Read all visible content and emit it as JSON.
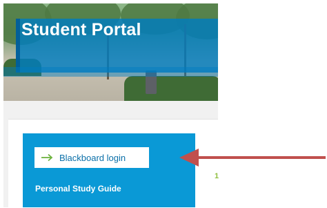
{
  "banner": {
    "title": "Student Portal"
  },
  "panel": {
    "login_button_label": "Blackboard login",
    "study_guide_label": "Personal Study Guide",
    "side_mark": "1"
  },
  "icons": {
    "login_arrow": "arrow-right-icon",
    "annotation_arrow": "arrow-left-icon"
  },
  "colors": {
    "accent_blue": "#0a99d6",
    "login_arrow_green": "#6db33f",
    "annotation_red": "#c0504d"
  }
}
